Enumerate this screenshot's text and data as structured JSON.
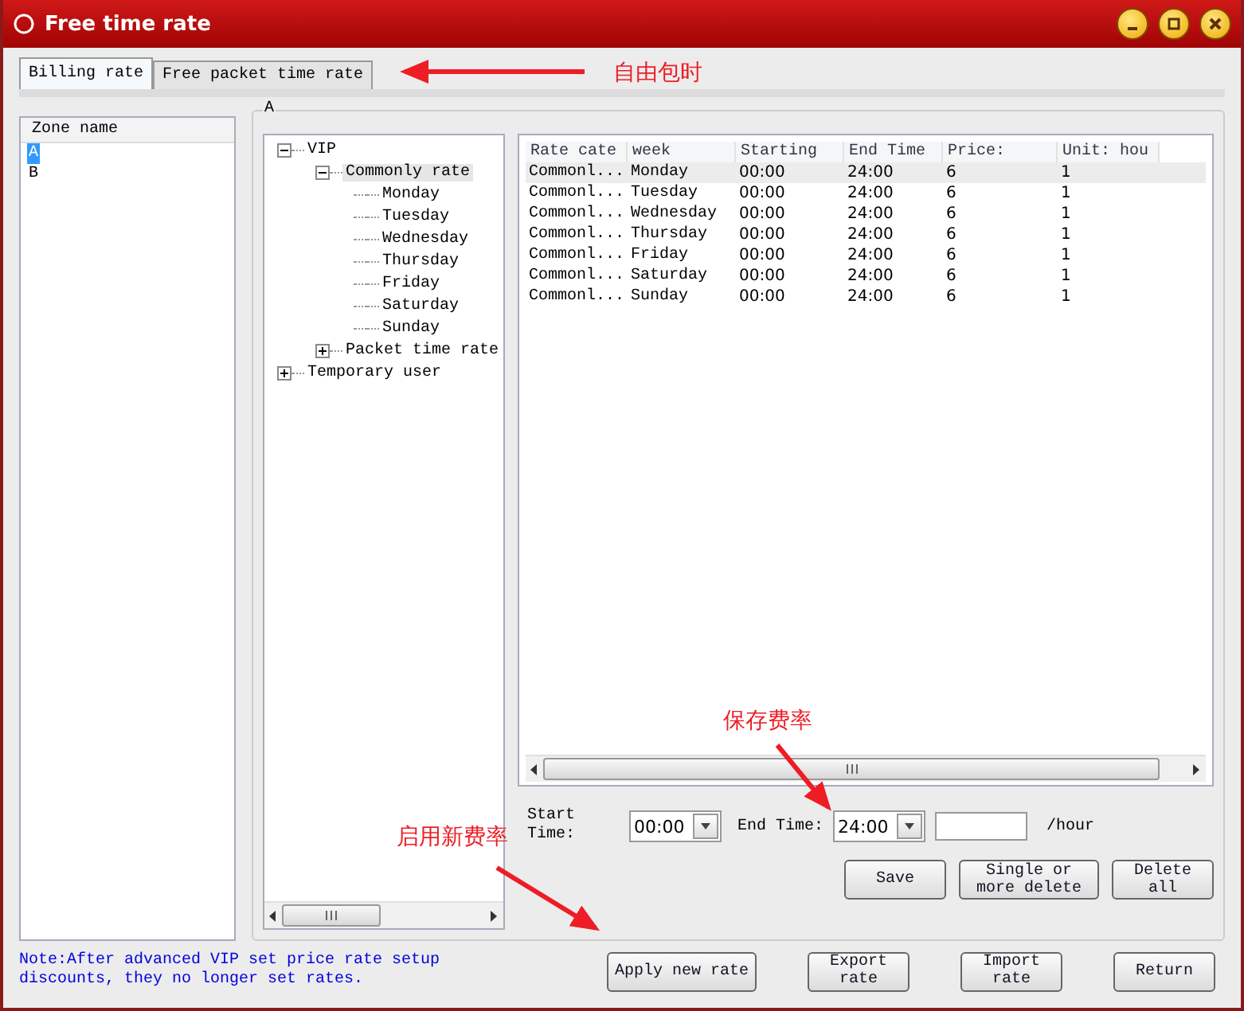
{
  "window": {
    "title": "Free time rate"
  },
  "tabs": [
    {
      "label": "Billing rate",
      "selected": true
    },
    {
      "label": "Free packet time rate",
      "selected": false
    }
  ],
  "zone_list": {
    "header": "Zone name",
    "items": [
      {
        "label": "A",
        "selected": true
      },
      {
        "label": "B",
        "selected": false
      }
    ]
  },
  "group": {
    "title": "A"
  },
  "tree": [
    {
      "label": "VIP",
      "expanded": true,
      "selected": false,
      "children": [
        {
          "label": "Commonly rate",
          "expanded": true,
          "selected": true,
          "children": [
            {
              "label": "Monday",
              "selected": false
            },
            {
              "label": "Tuesday",
              "selected": false
            },
            {
              "label": "Wednesday",
              "selected": false
            },
            {
              "label": "Thursday",
              "selected": false
            },
            {
              "label": "Friday",
              "selected": false
            },
            {
              "label": "Saturday",
              "selected": false
            },
            {
              "label": "Sunday",
              "selected": false
            }
          ]
        },
        {
          "label": "Packet time rate",
          "expanded": false,
          "selected": false
        }
      ]
    },
    {
      "label": "Temporary user",
      "expanded": false,
      "selected": false
    }
  ],
  "table": {
    "columns": [
      "Rate cate",
      "week",
      "Starting",
      "End Time",
      "Price:",
      "Unit: hou"
    ],
    "rows": [
      {
        "selected": true,
        "cells": [
          "Commonl...",
          "Monday",
          "00:00",
          "24:00",
          "6",
          "1"
        ]
      },
      {
        "selected": false,
        "cells": [
          "Commonl...",
          "Tuesday",
          "00:00",
          "24:00",
          "6",
          "1"
        ]
      },
      {
        "selected": false,
        "cells": [
          "Commonl...",
          "Wednesday",
          "00:00",
          "24:00",
          "6",
          "1"
        ]
      },
      {
        "selected": false,
        "cells": [
          "Commonl...",
          "Thursday",
          "00:00",
          "24:00",
          "6",
          "1"
        ]
      },
      {
        "selected": false,
        "cells": [
          "Commonl...",
          "Friday",
          "00:00",
          "24:00",
          "6",
          "1"
        ]
      },
      {
        "selected": false,
        "cells": [
          "Commonl...",
          "Saturday",
          "00:00",
          "24:00",
          "6",
          "1"
        ]
      },
      {
        "selected": false,
        "cells": [
          "Commonl...",
          "Sunday",
          "00:00",
          "24:00",
          "6",
          "1"
        ]
      }
    ]
  },
  "time_form": {
    "start_label": "Start Time:",
    "start_value": "00:00",
    "end_label": "End Time:",
    "end_value": "24:00",
    "unit": "/hour"
  },
  "rate_buttons": [
    "Save",
    "Single or more delete",
    "Delete all"
  ],
  "note": "Note:After advanced VIP set price rate setup discounts, they no longer set rates.",
  "bottom_buttons": [
    "Apply new rate",
    "Export rate",
    "Import rate",
    "Return"
  ],
  "annotations": [
    {
      "text": "自由包时"
    },
    {
      "text": "保存费率"
    },
    {
      "text": "启用新费率"
    }
  ]
}
